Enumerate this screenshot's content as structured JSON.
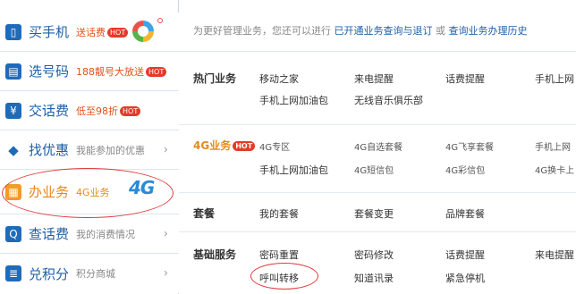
{
  "sidebar": {
    "items": [
      {
        "title": "买手机",
        "promo": "送话费",
        "badge": "HOT"
      },
      {
        "title": "选号码",
        "promo": "188靓号大放送",
        "badge": "HOT"
      },
      {
        "title": "交话费",
        "promo": "低至98折",
        "badge": "HOT"
      },
      {
        "title": "找优惠",
        "promo": "我能参加的优惠",
        "chevron": "›"
      },
      {
        "title": "办业务",
        "promo": "4G业务",
        "logo": "4G"
      },
      {
        "title": "查话费",
        "promo": "我的消费情况",
        "chevron": "›"
      },
      {
        "title": "兑积分",
        "promo": "积分商城",
        "chevron": "›"
      }
    ]
  },
  "topbar": {
    "text": "为更好管理业务，您还可以进行",
    "link1": "已开通业务查询与退订",
    "or": "或",
    "link2": "查询业务办理历史"
  },
  "sections": {
    "hot": {
      "title": "热门业务",
      "row1": [
        "移动之家",
        "来电提醒",
        "话费提醒",
        "手机上网"
      ],
      "row2": [
        "手机上网加油包",
        "无线音乐俱乐部"
      ]
    },
    "fourg": {
      "title": "4G业务",
      "badge": "HOT",
      "row1": [
        "4G专区",
        "4G自选套餐",
        "4G飞享套餐",
        "手机上网"
      ],
      "row2": [
        "手机上网加油包",
        "4G短信包",
        "4G彩信包",
        "4G换卡上"
      ]
    },
    "pkg": {
      "title": "套餐",
      "row1": [
        "我的套餐",
        "套餐变更",
        "品牌套餐"
      ]
    },
    "basic": {
      "title": "基础服务",
      "row1": [
        "密码重置",
        "密码修改",
        "话费提醒",
        "来电提醒"
      ],
      "row2": [
        "呼叫转移",
        "知道讯录",
        "紧急停机"
      ]
    }
  },
  "icons": [
    "phone-icon",
    "sim-icon",
    "bill-icon",
    "tag-icon",
    "clipboard-icon",
    "search-doc-icon",
    "points-icon"
  ],
  "colors": {
    "brand_blue": "#1f5fa8",
    "accent_orange": "#e58a1a",
    "highlight_circle": "#e0393a"
  }
}
